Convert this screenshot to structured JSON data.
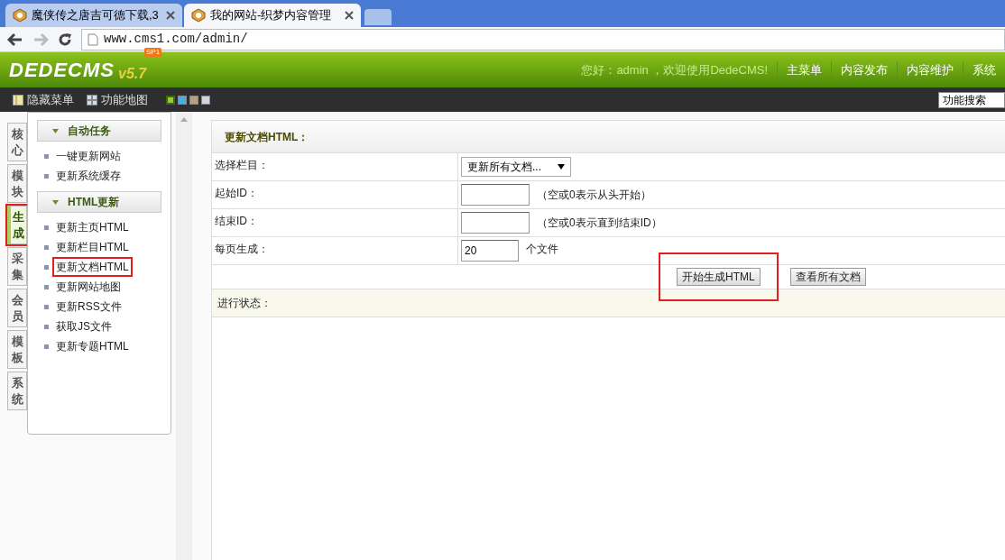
{
  "browser": {
    "tabs": [
      {
        "title": "魔侠传之唐吉可德下载,3",
        "selected": false
      },
      {
        "title": "我的网站-织梦内容管理",
        "selected": true
      }
    ],
    "url": "www.cms1.com/admin/"
  },
  "header": {
    "logo": "DEDECMS",
    "badge": "SP1",
    "version": "v5.7",
    "greeting": "您好：admin ，欢迎使用DedeCMS!",
    "nav": [
      "主菜单",
      "内容发布",
      "内容维护",
      "系统"
    ]
  },
  "toolbar": {
    "items": [
      "隐藏菜单",
      "功能地图"
    ],
    "skins": [
      {
        "color": "#9cc93a",
        "selected": true
      },
      {
        "color": "#4aaee0",
        "selected": false
      },
      {
        "color": "#b9a07a",
        "selected": false
      },
      {
        "color": "#d0d4dc",
        "selected": false
      }
    ],
    "search": "功能搜索"
  },
  "side_tabs": [
    {
      "label": "核心",
      "selected": false,
      "highlighted": false
    },
    {
      "label": "模块",
      "selected": false,
      "highlighted": false
    },
    {
      "label": "生成",
      "selected": true,
      "highlighted": true
    },
    {
      "label": "采集",
      "selected": false,
      "highlighted": false
    },
    {
      "label": "会员",
      "selected": false,
      "highlighted": false
    },
    {
      "label": "模板",
      "selected": false,
      "highlighted": false
    },
    {
      "label": "系统",
      "selected": false,
      "highlighted": false
    }
  ],
  "menu": [
    {
      "title": "自动任务",
      "items": [
        {
          "label": "一键更新网站",
          "highlighted": false
        },
        {
          "label": "更新系统缓存",
          "highlighted": false
        }
      ]
    },
    {
      "title": "HTML更新",
      "items": [
        {
          "label": "更新主页HTML",
          "highlighted": false
        },
        {
          "label": "更新栏目HTML",
          "highlighted": false
        },
        {
          "label": "更新文档HTML",
          "highlighted": true
        },
        {
          "label": "更新网站地图",
          "highlighted": false
        },
        {
          "label": "更新RSS文件",
          "highlighted": false
        },
        {
          "label": "获取JS文件",
          "highlighted": false
        },
        {
          "label": "更新专题HTML",
          "highlighted": false
        }
      ]
    }
  ],
  "form": {
    "title": "更新文档HTML：",
    "rows": [
      {
        "label": "选择栏目：",
        "kind": "select",
        "value": "更新所有文档...",
        "hint": ""
      },
      {
        "label": "起始ID：",
        "kind": "input",
        "value": "",
        "hint": "（空或0表示从头开始）"
      },
      {
        "label": "结束ID：",
        "kind": "input",
        "value": "",
        "hint": "（空或0表示直到结束ID）"
      },
      {
        "label": "每页生成：",
        "kind": "small",
        "value": "20",
        "hint": "个文件"
      }
    ],
    "buttons": [
      {
        "label": "开始生成HTML",
        "highlighted": true
      },
      {
        "label": "查看所有文档",
        "highlighted": false
      }
    ],
    "status_label": "进行状态："
  }
}
